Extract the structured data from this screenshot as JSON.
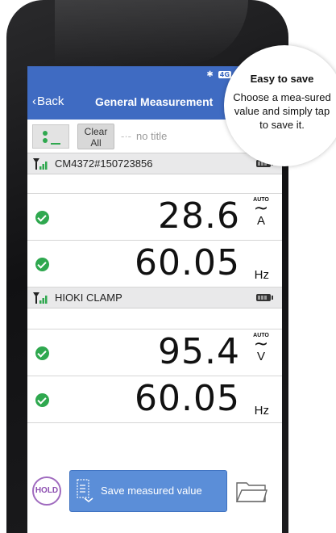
{
  "header": {
    "back_label": "Back",
    "title": "General Measurement",
    "status_network": "4G"
  },
  "toolbar": {
    "clear_label_line1": "Clear",
    "clear_label_line2": "All",
    "title_placeholder": "no title"
  },
  "devices": [
    {
      "name": "CM4372#150723856",
      "readings": [
        {
          "value": "28.6",
          "unit": "A",
          "mode": "AUTO",
          "wave": "~"
        },
        {
          "value": "60.05",
          "unit": "Hz"
        }
      ]
    },
    {
      "name": "HIOKI CLAMP",
      "readings": [
        {
          "value": "95.4",
          "unit": "V",
          "mode": "AUTO",
          "wave": "~"
        },
        {
          "value": "60.05",
          "unit": "Hz"
        }
      ]
    }
  ],
  "actions": {
    "hold_label": "HOLD",
    "save_label": "Save measured value"
  },
  "callout": {
    "title": "Easy to save",
    "body": "Choose a mea-sured value and simply tap to save it."
  },
  "colors": {
    "accent_blue": "#3f6bc2",
    "save_button": "#5b8ed8",
    "ok_green": "#2fa84f",
    "hold_purple": "#8d4fb1"
  },
  "icons": [
    "bluetooth-icon",
    "signal-icon",
    "battery-icon",
    "check-icon",
    "folder-icon",
    "save-icon",
    "list-icon"
  ]
}
